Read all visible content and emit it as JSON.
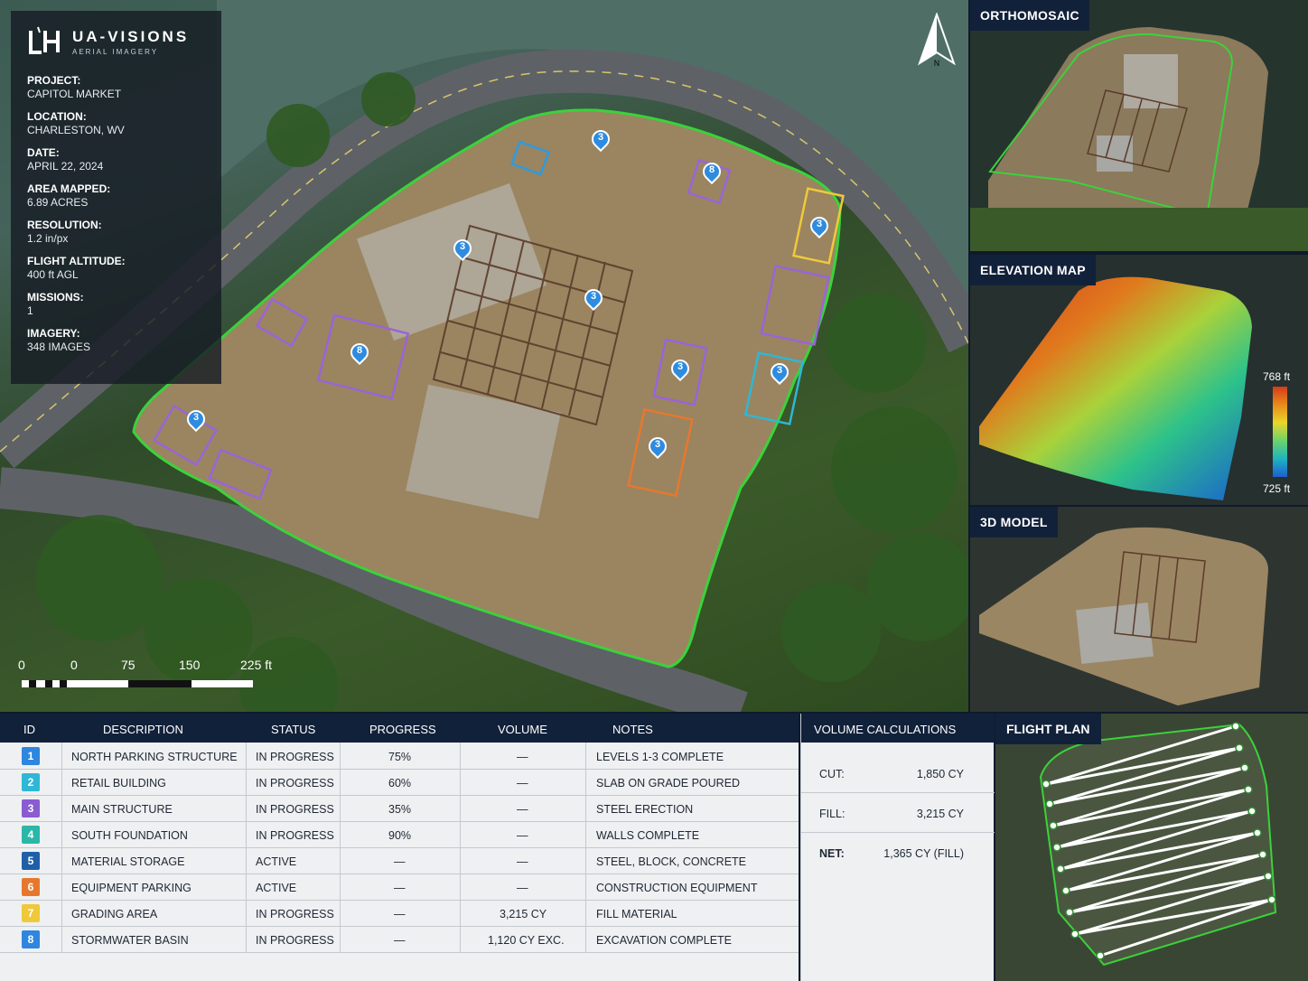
{
  "brand": {
    "name": "UA-VISIONS",
    "tagline": "AERIAL IMAGERY"
  },
  "project_info": [
    {
      "label": "PROJECT:",
      "value": "CAPITOL MARKET"
    },
    {
      "label": "LOCATION:",
      "value": "CHARLESTON, WV"
    },
    {
      "label": "DATE:",
      "value": "APRIL 22, 2024"
    },
    {
      "label": "AREA MAPPED:",
      "value": "6.89 ACRES"
    },
    {
      "label": "RESOLUTION:",
      "value": "1.2 in/px"
    },
    {
      "label": "FLIGHT ALTITUDE:",
      "value": "400 ft AGL"
    },
    {
      "label": "MISSIONS:",
      "value": "1"
    },
    {
      "label": "IMAGERY:",
      "value": "348 IMAGES"
    }
  ],
  "north_label": "N",
  "scale": {
    "ticks": [
      "0",
      "0",
      "75",
      "150",
      "225 ft"
    ]
  },
  "map_markers": [
    "3",
    "8",
    "3",
    "3",
    "3",
    "8",
    "3",
    "3",
    "3",
    "3"
  ],
  "panels": {
    "ortho_title": "ORTHOMOSAIC",
    "elevation_title": "ELEVATION MAP",
    "elevation_max": "768 ft",
    "elevation_min": "725 ft",
    "model_title": "3D MODEL",
    "flight_title": "FLIGHT PLAN"
  },
  "table": {
    "headers": {
      "id": "ID",
      "description": "DESCRIPTION",
      "status": "STATUS",
      "progress": "PROGRESS",
      "volume": "VOLUME",
      "notes": "NOTES"
    },
    "rows": [
      {
        "id": "1",
        "color": "#2e86de",
        "description": "NORTH PARKING STRUCTURE",
        "status": "IN PROGRESS",
        "progress": "75%",
        "volume": "—",
        "notes": "LEVELS 1-3 COMPLETE"
      },
      {
        "id": "2",
        "color": "#2fb7d6",
        "description": "RETAIL BUILDING",
        "status": "IN PROGRESS",
        "progress": "60%",
        "volume": "—",
        "notes": "SLAB ON GRADE POURED"
      },
      {
        "id": "3",
        "color": "#8a5bd1",
        "description": "MAIN STRUCTURE",
        "status": "IN PROGRESS",
        "progress": "35%",
        "volume": "—",
        "notes": "STEEL ERECTION"
      },
      {
        "id": "4",
        "color": "#2bb7a8",
        "description": "SOUTH FOUNDATION",
        "status": "IN PROGRESS",
        "progress": "90%",
        "volume": "—",
        "notes": "WALLS COMPLETE"
      },
      {
        "id": "5",
        "color": "#1f5fa8",
        "description": "MATERIAL STORAGE",
        "status": "ACTIVE",
        "progress": "—",
        "volume": "—",
        "notes": "STEEL, BLOCK, CONCRETE"
      },
      {
        "id": "6",
        "color": "#e8772e",
        "description": "EQUIPMENT PARKING",
        "status": "ACTIVE",
        "progress": "—",
        "volume": "—",
        "notes": "CONSTRUCTION EQUIPMENT"
      },
      {
        "id": "7",
        "color": "#f0c93a",
        "description": "GRADING AREA",
        "status": "IN PROGRESS",
        "progress": "—",
        "volume": "3,215 CY",
        "notes": "FILL MATERIAL"
      },
      {
        "id": "8",
        "color": "#2e86de",
        "description": "STORMWATER BASIN",
        "status": "IN PROGRESS",
        "progress": "—",
        "volume": "1,120 CY EXC.",
        "notes": "EXCAVATION COMPLETE"
      }
    ]
  },
  "volume": {
    "title": "VOLUME CALCULATIONS",
    "cut_label": "CUT:",
    "cut_value": "1,850 CY",
    "fill_label": "FILL:",
    "fill_value": "3,215 CY",
    "net_label": "NET:",
    "net_value": "1,365 CY (FILL)"
  }
}
